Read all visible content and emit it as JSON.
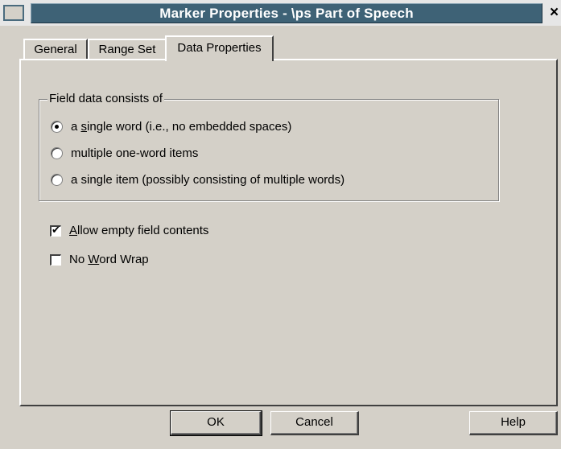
{
  "window": {
    "title": "Marker Properties - \\ps Part of Speech",
    "close_glyph": "×"
  },
  "tabs": [
    {
      "label": "General",
      "active": false
    },
    {
      "label": "Range Set",
      "active": false
    },
    {
      "label": "Data Properties",
      "active": true
    }
  ],
  "field_group": {
    "label": "Field data consists of",
    "options": [
      {
        "pre": "a ",
        "mnemonic": "s",
        "post": "ingle word (i.e., no embedded spaces)",
        "checked": true
      },
      {
        "pre": "",
        "mnemonic": "",
        "post": "multiple one-word items",
        "checked": false
      },
      {
        "pre": "",
        "mnemonic": "",
        "post": "a single item (possibly consisting of multiple words)",
        "checked": false
      }
    ]
  },
  "checkboxes": [
    {
      "pre": "",
      "mnemonic": "A",
      "post": "llow empty field contents",
      "checked": true
    },
    {
      "pre": "No ",
      "mnemonic": "W",
      "post": "ord Wrap",
      "checked": false
    }
  ],
  "buttons": {
    "ok": "OK",
    "cancel": "Cancel",
    "help": "Help"
  },
  "colors": {
    "title_bar": "#3e6276",
    "face": "#d4d0c8"
  }
}
